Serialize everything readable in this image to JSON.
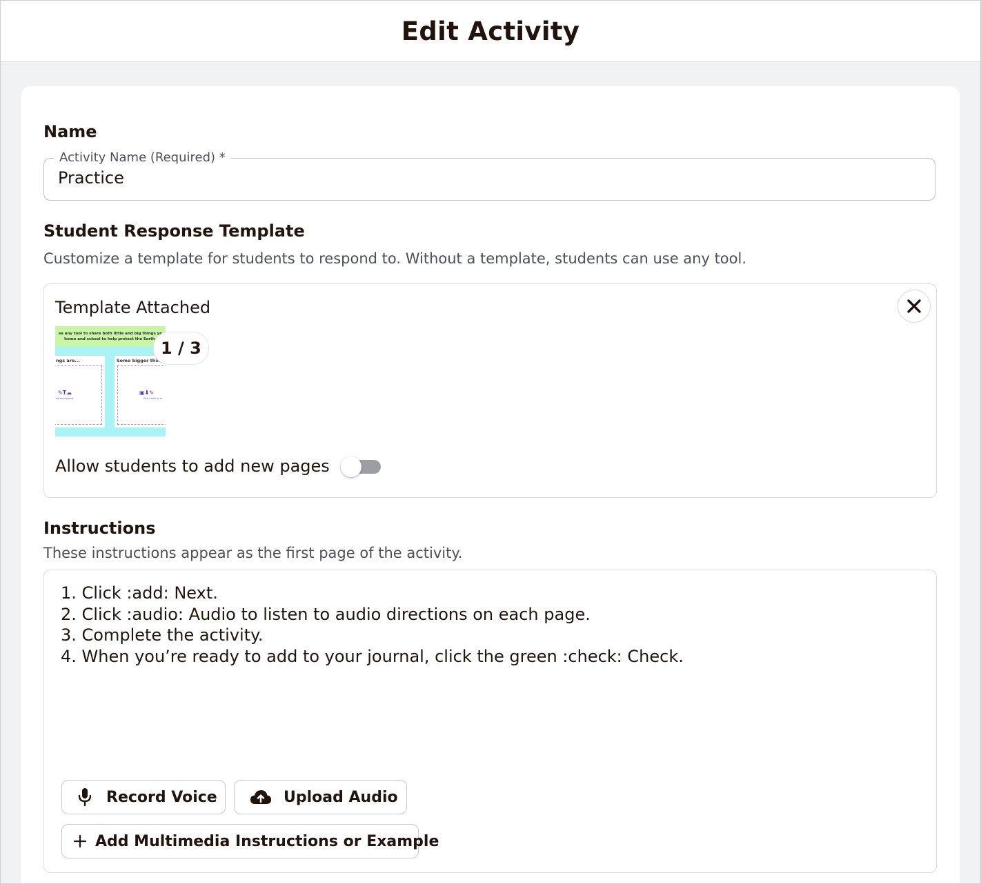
{
  "header": {
    "title": "Edit Activity"
  },
  "name_section": {
    "title": "Name",
    "field_label": "Activity Name (Required) *",
    "field_value": "Practice"
  },
  "template_section": {
    "title": "Student Response Template",
    "description": "Customize a template for students to respond to. Without a template, students can use any tool.",
    "attached_label": "Template Attached",
    "page_counter": "1 / 3",
    "thumbnail": {
      "banner_line1": "se any tool to share both little and big things yo",
      "banner_line2": "home and school to help protect the Earth.",
      "left_panel_title": "ngs are...",
      "right_panel_title": "Some bigger thing",
      "left_tools": "✎T☁",
      "right_tools": "▣⬇✎",
      "left_hint": "ool to respond",
      "right_hint": "Pick a tool to re"
    },
    "allow_pages_label": "Allow students to add new pages",
    "allow_pages_value": 0
  },
  "instructions_section": {
    "title": "Instructions",
    "description": "These instructions appear as the first page of the activity.",
    "lines": [
      "1. Click :add: Next.",
      "2. Click :audio: Audio to listen to audio directions on each page.",
      "3. Complete the activity.",
      "4. When you’re ready to add to your journal, click the green :check: Check."
    ],
    "record_voice_label": "Record Voice",
    "upload_audio_label": "Upload Audio",
    "add_multimedia_label": "Add Multimedia Instructions or Example"
  },
  "icons": {
    "close": "close-icon",
    "microphone": "microphone-icon",
    "upload": "cloud-upload-icon",
    "add": "plus-icon"
  },
  "colors": {
    "text": "#22140d",
    "muted": "#4b4f57",
    "page_bg": "#f1f2f4",
    "thumb_cyan": "#a8f3f6",
    "thumb_green": "#c8f6a6",
    "toggle_off": "#9d9ea3"
  }
}
